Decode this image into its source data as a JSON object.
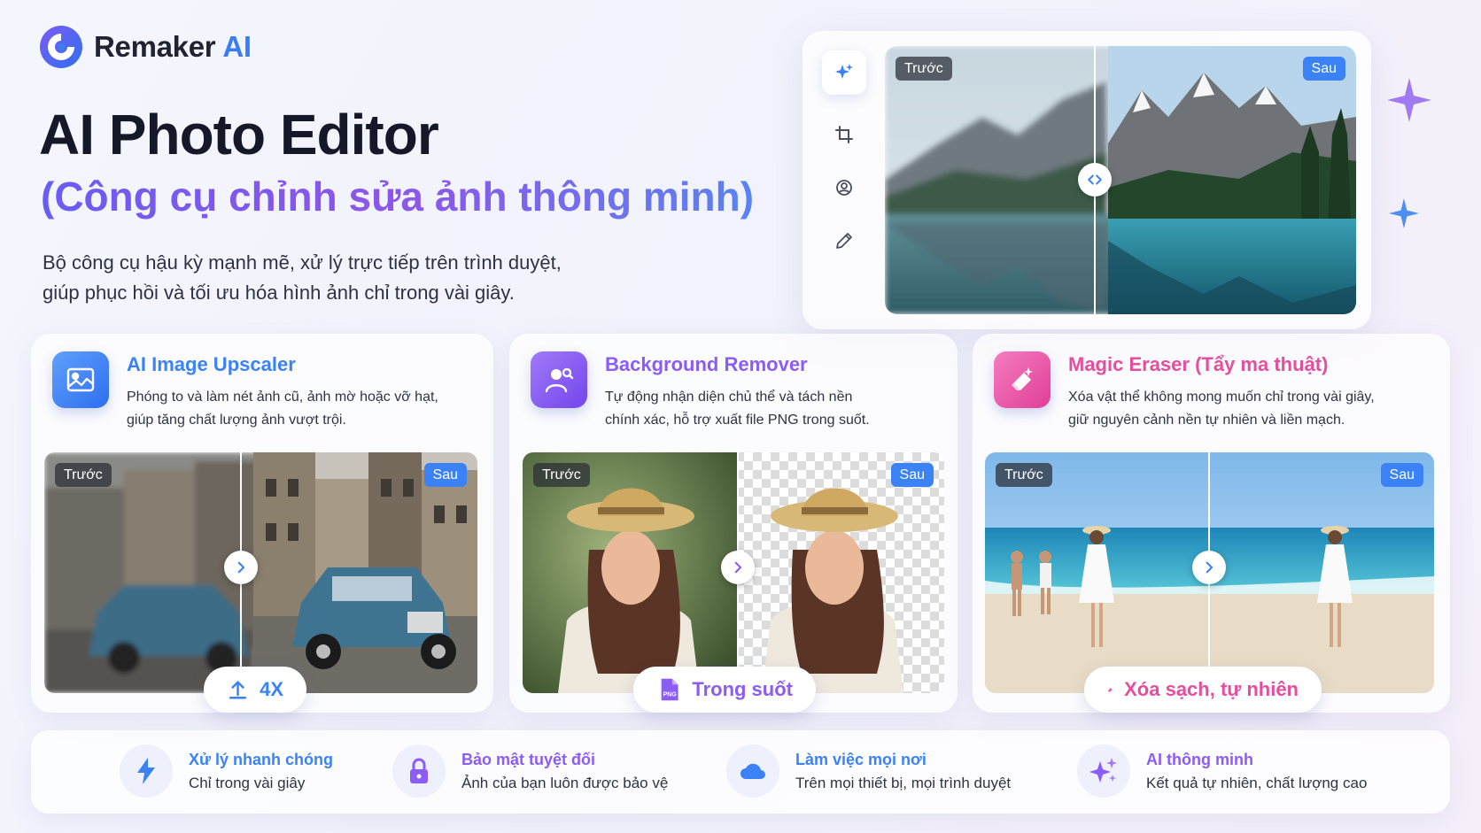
{
  "brand": {
    "name": "Remaker",
    "suffix": "AI"
  },
  "hero": {
    "title": "AI Photo Editor",
    "subtitle": "(Công cụ chỉnh sửa ảnh thông minh)",
    "description_line1": "Bộ công cụ hậu kỳ mạnh mẽ, xử lý trực tiếp trên trình duyệt,",
    "description_line2": "giúp phục hồi và tối ưu hóa hình ảnh chỉ trong vài giây."
  },
  "editor": {
    "tools": [
      "magic-sparkle-icon",
      "crop-icon",
      "face-retouch-icon",
      "pencil-icon"
    ],
    "before_label": "Trước",
    "after_label": "Sau"
  },
  "cards": [
    {
      "title": "AI Image Upscaler",
      "description_line1": "Phóng to và làm nét ảnh cũ, ảnh mờ hoặc vỡ hạt,",
      "description_line2": "giúp tăng chất lượng ảnh vượt trội.",
      "before_label": "Trước",
      "after_label": "Sau",
      "pill": "4X",
      "color": "#3b82f6"
    },
    {
      "title": "Background Remover",
      "description_line1": "Tự động nhận diện chủ thể và tách nền",
      "description_line2": "chính xác, hỗ trợ xuất file PNG trong suốt.",
      "before_label": "Trước",
      "after_label": "Sau",
      "pill": "Trong suốt",
      "color": "#8b5cf6"
    },
    {
      "title": "Magic Eraser (Tẩy ma thuật)",
      "description_line1": "Xóa vật thể không mong muốn chỉ trong vài giây,",
      "description_line2": "giữ nguyên cảnh nền tự nhiên và liền mạch.",
      "before_label": "Trước",
      "after_label": "Sau",
      "pill": "Xóa sạch, tự nhiên",
      "color": "#e54e9e"
    }
  ],
  "pill_icon_text": "PNG",
  "features": [
    {
      "title": "Xử lý nhanh chóng",
      "subtitle": "Chỉ trong vài giây",
      "icon": "lightning-icon"
    },
    {
      "title": "Bảo mật tuyệt đối",
      "subtitle": "Ảnh của bạn luôn được bảo vệ",
      "icon": "lock-icon"
    },
    {
      "title": "Làm việc mọi nơi",
      "subtitle": "Trên mọi thiết bị, mọi trình duyệt",
      "icon": "cloud-icon"
    },
    {
      "title": "AI thông minh",
      "subtitle": "Kết quả tự nhiên, chất lượng cao",
      "icon": "sparkles-icon"
    }
  ],
  "colors": {
    "blue": "#3b82f6",
    "purple": "#8b5cf6",
    "pink": "#e54e9e",
    "title_dark": "#141828"
  }
}
